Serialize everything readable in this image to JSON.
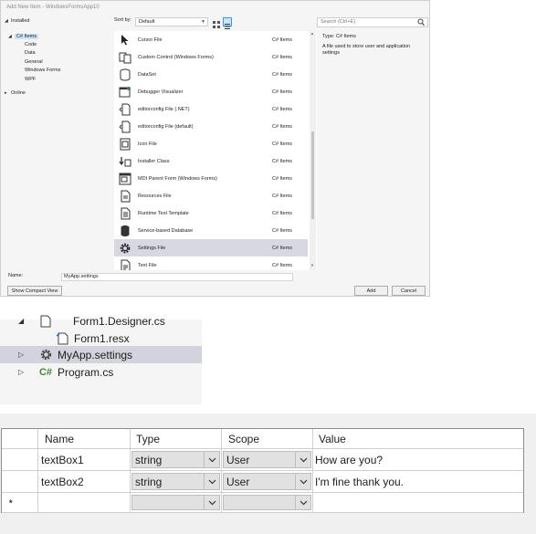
{
  "dialog": {
    "title": "Add New Item - WindowsFormsApp10",
    "tree": {
      "installed": "Installed",
      "csharp_items": "C# Items",
      "children": [
        "Code",
        "Data",
        "General",
        "Windows Forms",
        "WPF"
      ],
      "online": "Online"
    },
    "sort_label": "Sort by:",
    "sort_value": "Default",
    "search_placeholder": "Search (Ctrl+E)",
    "items": [
      {
        "name": "Cursor File",
        "category": "C# Items",
        "icon": "cursor-icon"
      },
      {
        "name": "Custom Control (Windows Forms)",
        "category": "C# Items",
        "icon": "custom-control-icon"
      },
      {
        "name": "DataSet",
        "category": "C# Items",
        "icon": "dataset-icon"
      },
      {
        "name": "Debugger Visualizer",
        "category": "C# Items",
        "icon": "debugger-visualizer-icon"
      },
      {
        "name": "editorconfig File (.NET)",
        "category": "C# Items",
        "icon": "editorconfig-icon"
      },
      {
        "name": "editorconfig File (default)",
        "category": "C# Items",
        "icon": "editorconfig-icon"
      },
      {
        "name": "Icon File",
        "category": "C# Items",
        "icon": "icon-file-icon"
      },
      {
        "name": "Installer Class",
        "category": "C# Items",
        "icon": "installer-class-icon"
      },
      {
        "name": "MDI Parent Form (Windows Forms)",
        "category": "C# Items",
        "icon": "mdi-form-icon"
      },
      {
        "name": "Resources File",
        "category": "C# Items",
        "icon": "resources-file-icon"
      },
      {
        "name": "Runtime Text Template",
        "category": "C# Items",
        "icon": "text-template-icon"
      },
      {
        "name": "Service-based Database",
        "category": "C# Items",
        "icon": "database-icon"
      },
      {
        "name": "Settings File",
        "category": "C# Items",
        "icon": "settings-gear-icon"
      },
      {
        "name": "Text File",
        "category": "C# Items",
        "icon": "text-file-icon"
      }
    ],
    "selected_item": "Settings File",
    "details": {
      "type_label": "Type:",
      "type_value": "C# Items",
      "description": "A file used to store user and application settings"
    },
    "name_label": "Name:",
    "name_value": "MyApp.settings",
    "compact_view_button": "Show Compact View",
    "add_button": "Add",
    "cancel_button": "Cancel"
  },
  "solution_explorer": {
    "rows": [
      {
        "label": "Form1.Designer.cs",
        "icon": "file-icon"
      },
      {
        "label": "Form1.resx",
        "icon": "resx-file-icon"
      },
      {
        "label": "MyApp.settings",
        "icon": "settings-gear-icon"
      },
      {
        "label": "Program.cs",
        "icon": "csharp-file-icon",
        "icon_text": "C#"
      }
    ]
  },
  "settings_grid": {
    "columns": [
      "Name",
      "Type",
      "Scope",
      "Value"
    ],
    "rows": [
      {
        "name": "textBox1",
        "type": "string",
        "scope": "User",
        "value": "How are you?"
      },
      {
        "name": "textBox2",
        "type": "string",
        "scope": "User",
        "value": "I'm fine thank you."
      }
    ],
    "new_row_marker": "*"
  },
  "colors": {
    "selection": "#d7d8e3",
    "tree_selection": "#cce4f7",
    "dialog_bg": "#f5f5f5"
  }
}
